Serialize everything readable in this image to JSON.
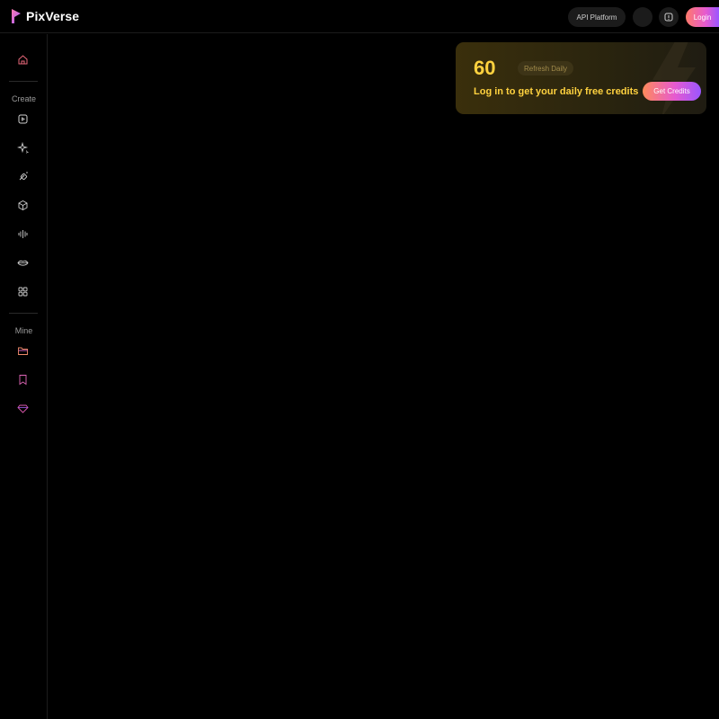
{
  "header": {
    "brand": "PixVerse",
    "api_label": "API Platform",
    "login_label": "Login"
  },
  "sidebar": {
    "sections": [
      {
        "label": "Create"
      },
      {
        "label": "Mine"
      }
    ],
    "items": [
      {
        "icon": "home-icon"
      },
      {
        "icon": "video-create-icon"
      },
      {
        "icon": "sparkle-icon"
      },
      {
        "icon": "magic-wand-icon"
      },
      {
        "icon": "cube-icon"
      },
      {
        "icon": "audio-wave-icon"
      },
      {
        "icon": "lips-icon"
      },
      {
        "icon": "grid-icon"
      },
      {
        "icon": "folder-icon"
      },
      {
        "icon": "bookmark-icon"
      },
      {
        "icon": "diamond-icon"
      }
    ]
  },
  "credits": {
    "amount": "60",
    "badge": "Refresh Daily",
    "message": "Log in to get your daily free credits",
    "button": "Get Credits"
  },
  "colors": {
    "accent_gradient_start": "#ff7a6a",
    "accent_gradient_mid": "#e65ad0",
    "accent_gradient_end": "#9a56ff",
    "credit_yellow": "#ffd23f"
  }
}
